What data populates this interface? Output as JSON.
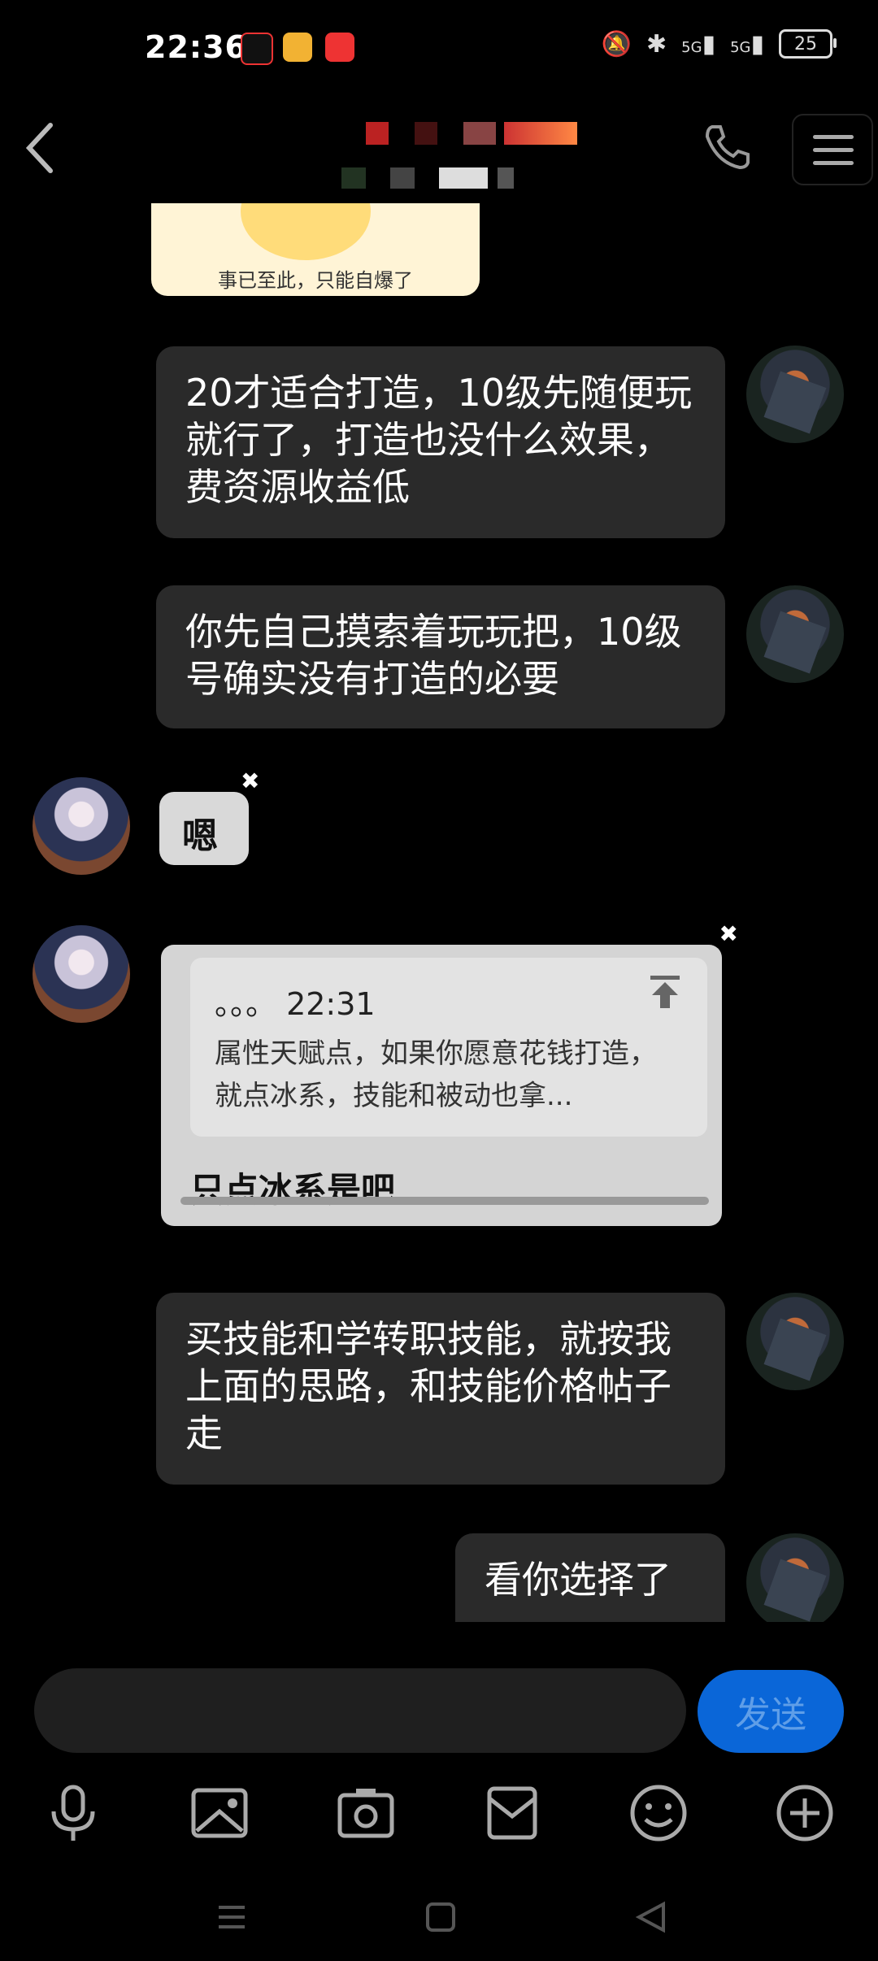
{
  "status_bar": {
    "time": "22:36",
    "network": "5G",
    "network2": "5G",
    "battery": "25"
  },
  "header": {
    "title_redacted": true
  },
  "messages": {
    "sticker_top_caption": "事已至此，只能自爆了",
    "m1": "20才适合打造，10级先随便玩就行了，打造也没什么效果，费资源收益低",
    "m2": "你先自己摸索着玩玩把，10级号确实没有打造的必要",
    "sticker_small_text": "嗯",
    "quote": {
      "header": "。。。 22:31",
      "text": "属性天赋点，如果你愿意花钱打造，就点冰系，技能和被动也拿...",
      "reply": "只点冰系是吧"
    },
    "m3": "买技能和学转职技能，就按我上面的思路，和技能价格帖子走",
    "m4": "看你选择了"
  },
  "input": {
    "value": "",
    "placeholder": "",
    "send_label": "发送"
  },
  "toolbar": {
    "icons": [
      "mic-icon",
      "image-icon",
      "camera-icon",
      "envelope-icon",
      "emoji-icon",
      "plus-icon"
    ]
  },
  "colors": {
    "send_bg": "#0a66d8",
    "bubble_bg": "#2a2a2a",
    "bg": "#000000"
  }
}
